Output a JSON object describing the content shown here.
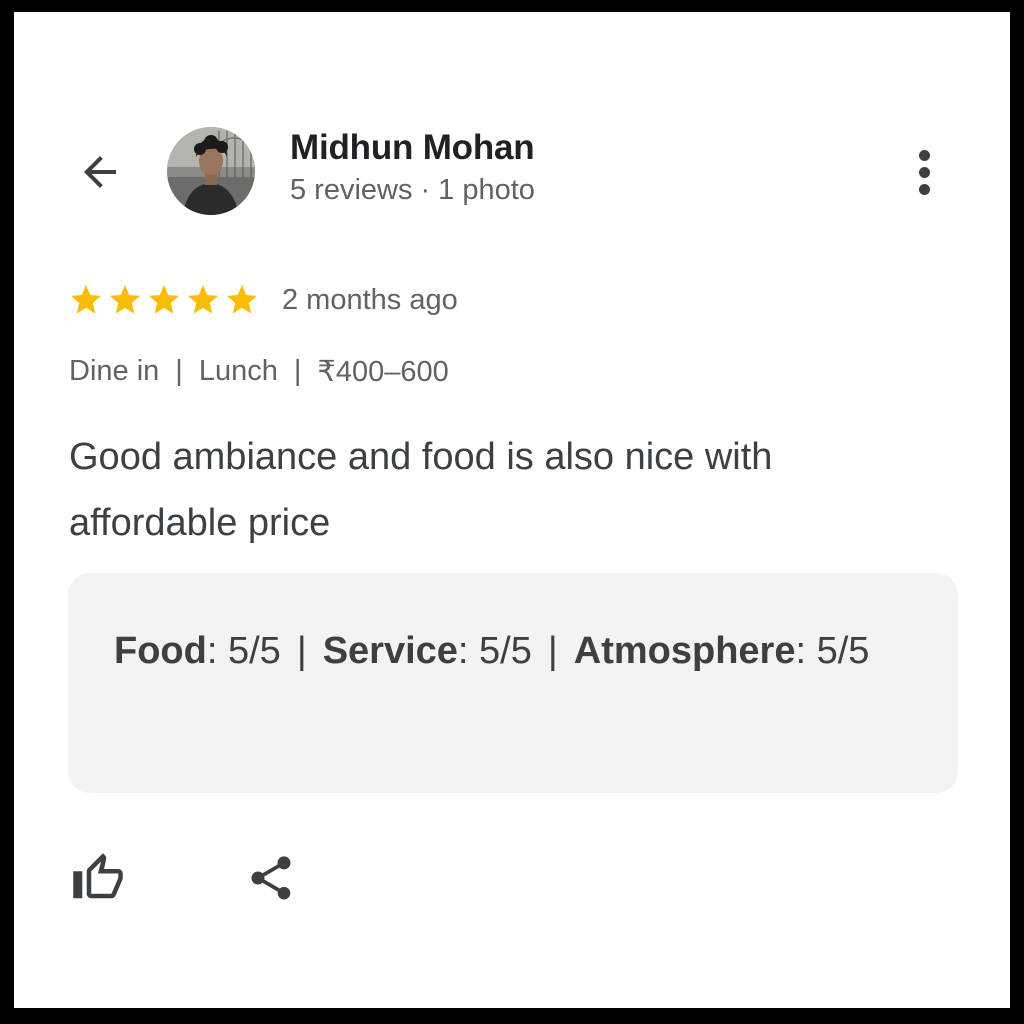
{
  "header": {
    "back_icon": "arrow-back-icon",
    "reviewer_name": "Midhun Mohan",
    "reviews_count": "5 reviews",
    "separator": "·",
    "photos_count": "1 photo",
    "more_icon": "more-vert-icon"
  },
  "rating": {
    "stars": 5,
    "max_stars": 5,
    "star_color": "#fbbc04",
    "time_ago": "2 months ago"
  },
  "context": {
    "service_type": "Dine in",
    "meal_type": "Lunch",
    "price_range": "₹400–600",
    "separator": "|"
  },
  "review": {
    "text": "Good ambiance and food is also nice with affordable price"
  },
  "subratings": {
    "food_label": "Food",
    "food_value": ": 5/5",
    "service_label": "Service",
    "service_value": ": 5/5",
    "atmosphere_label": "Atmosphere",
    "atmosphere_value": ": 5/5",
    "separator": "|"
  },
  "actions": {
    "like_icon": "thumb-up-icon",
    "share_icon": "share-icon"
  }
}
